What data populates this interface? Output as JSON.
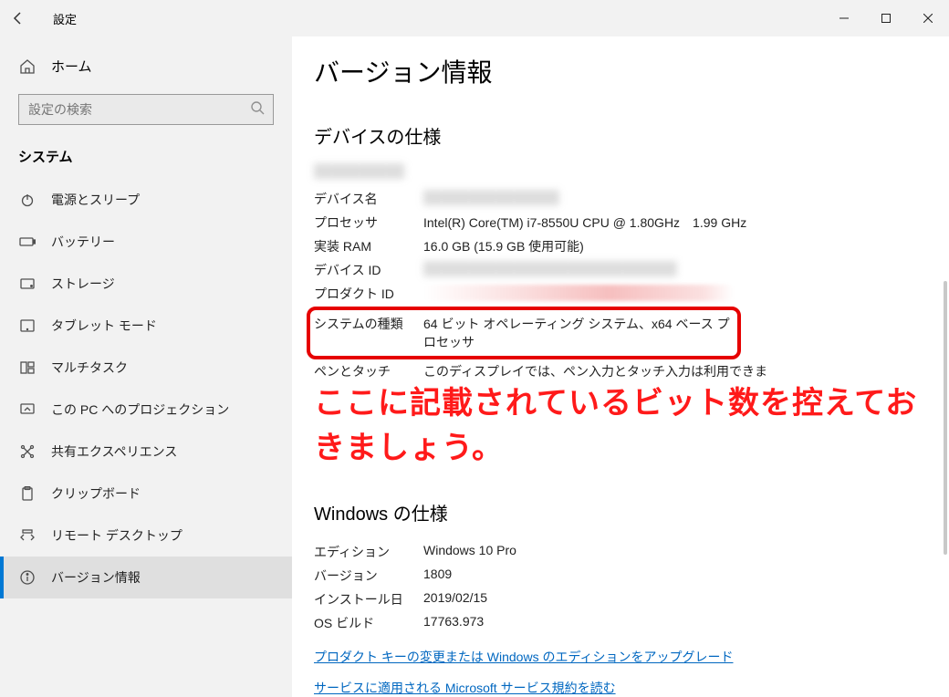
{
  "titlebar": {
    "title": "設定"
  },
  "sidebar": {
    "home_label": "ホーム",
    "search_placeholder": "設定の検索",
    "category": "システム",
    "items": [
      {
        "label": "電源とスリープ",
        "icon": "power-icon"
      },
      {
        "label": "バッテリー",
        "icon": "battery-icon"
      },
      {
        "label": "ストレージ",
        "icon": "storage-icon"
      },
      {
        "label": "タブレット モード",
        "icon": "tablet-icon"
      },
      {
        "label": "マルチタスク",
        "icon": "multitask-icon"
      },
      {
        "label": "この PC へのプロジェクション",
        "icon": "projection-icon"
      },
      {
        "label": "共有エクスペリエンス",
        "icon": "shared-icon"
      },
      {
        "label": "クリップボード",
        "icon": "clipboard-icon"
      },
      {
        "label": "リモート デスクトップ",
        "icon": "remote-icon"
      },
      {
        "label": "バージョン情報",
        "icon": "info-icon"
      }
    ]
  },
  "content": {
    "page_title": "バージョン情報",
    "device_specs_heading": "デバイスの仕様",
    "device_specs": {
      "device_name": {
        "label": "デバイス名",
        "value": ""
      },
      "processor": {
        "label": "プロセッサ",
        "value": "Intel(R) Core(TM) i7-8550U CPU @ 1.80GHz　1.99 GHz"
      },
      "ram": {
        "label": "実装 RAM",
        "value": "16.0 GB (15.9 GB 使用可能)"
      },
      "device_id": {
        "label": "デバイス ID",
        "value": ""
      },
      "product_id": {
        "label": "プロダクト ID",
        "value": ""
      },
      "system_type": {
        "label": "システムの種類",
        "value": "64 ビット オペレーティング システム、x64 ベース プロセッサ"
      },
      "pen_touch": {
        "label": "ペンとタッチ",
        "value": "このディスプレイでは、ペン入力とタッチ入力は利用できま"
      }
    },
    "windows_specs_heading": "Windows の仕様",
    "windows_specs": {
      "edition": {
        "label": "エディション",
        "value": "Windows 10 Pro"
      },
      "version": {
        "label": "バージョン",
        "value": "1809"
      },
      "installed": {
        "label": "インストール日",
        "value": "2019/02/15"
      },
      "os_build": {
        "label": "OS ビルド",
        "value": "17763.973"
      }
    },
    "links": {
      "product_key": "プロダクト キーの変更または Windows のエディションをアップグレード",
      "service_terms": "サービスに適用される Microsoft サービス規約を読む"
    },
    "annotation": "ここに記載されているビット数を控えておきましょう。"
  }
}
